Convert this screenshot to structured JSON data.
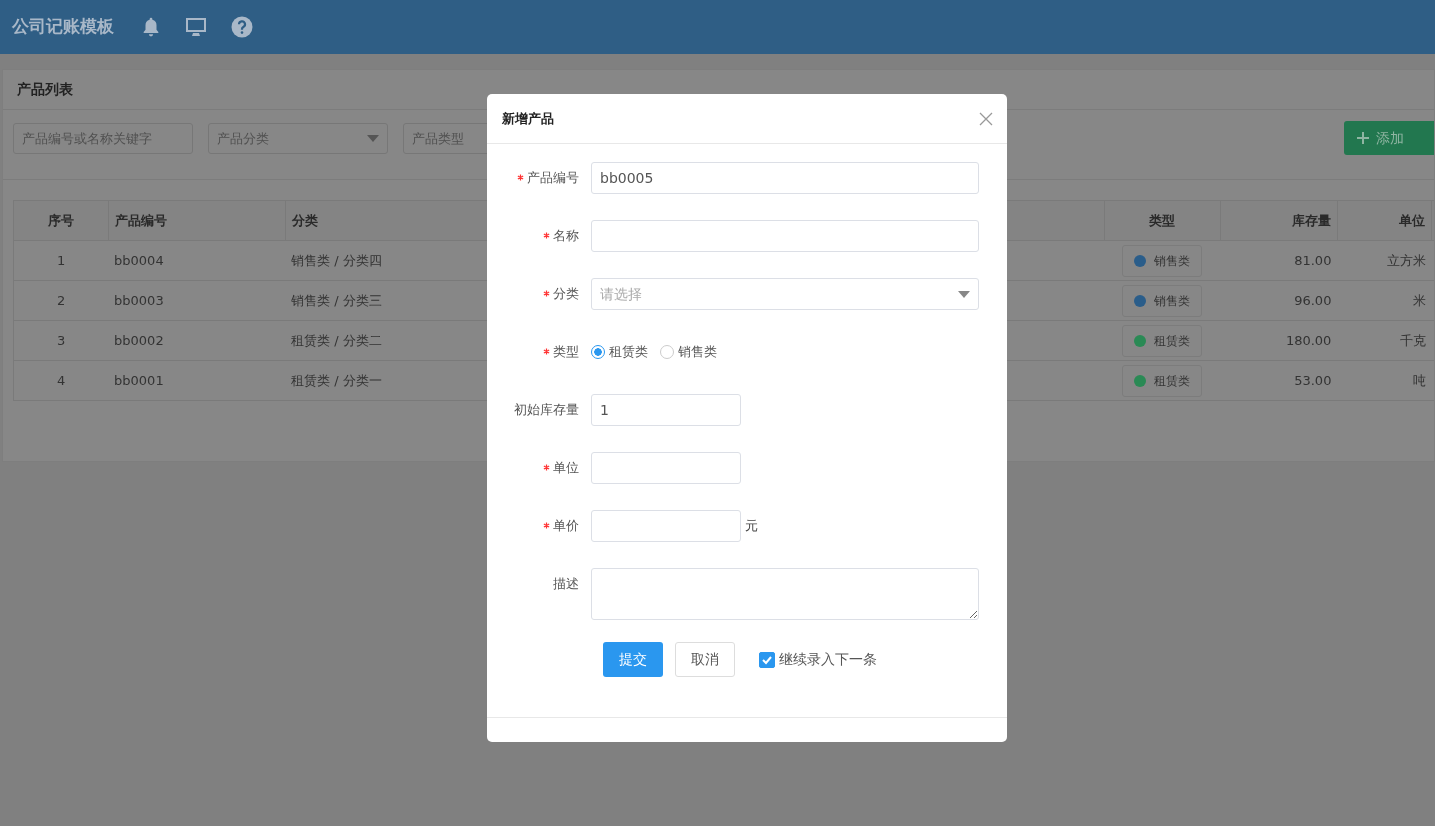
{
  "header": {
    "title": "公司记账模板"
  },
  "panel": {
    "title": "产品列表",
    "filters": [
      {
        "kind": "input",
        "placeholder": "产品编号或名称关键字"
      },
      {
        "kind": "select",
        "placeholder": "产品分类"
      },
      {
        "kind": "input",
        "placeholder": "产品类型"
      }
    ],
    "add_button": "添加"
  },
  "table": {
    "columns": [
      "序号",
      "产品编号",
      "分类",
      "类型",
      "库存量",
      "单位"
    ],
    "rows": [
      {
        "index": "1",
        "code": "bb0004",
        "category": "销售类 / 分类四",
        "type": {
          "label": "销售类",
          "color": "#2a5d8a"
        },
        "stock": "81.00",
        "unit": "立方米"
      },
      {
        "index": "2",
        "code": "bb0003",
        "category": "销售类 / 分类三",
        "type": {
          "label": "销售类",
          "color": "#2a5d8a"
        },
        "stock": "96.00",
        "unit": "米"
      },
      {
        "index": "3",
        "code": "bb0002",
        "category": "租赁类 / 分类二",
        "type": {
          "label": "租赁类",
          "color": "#2a8a55"
        },
        "stock": "180.00",
        "unit": "千克"
      },
      {
        "index": "4",
        "code": "bb0001",
        "category": "租赁类 / 分类一",
        "type": {
          "label": "租赁类",
          "color": "#2a8a55"
        },
        "stock": "53.00",
        "unit": "吨"
      }
    ]
  },
  "dialog": {
    "title": "新增产品",
    "fields": [
      {
        "kind": "text",
        "label": "产品编号",
        "required": true,
        "value": "bb0005"
      },
      {
        "kind": "text",
        "label": "名称",
        "required": true
      },
      {
        "kind": "select",
        "label": "分类",
        "required": true,
        "placeholder": "请选择"
      },
      {
        "kind": "radio",
        "label": "类型",
        "required": true,
        "options": [
          {
            "label": "租赁类",
            "selected": true
          },
          {
            "label": "销售类",
            "selected": false
          }
        ]
      },
      {
        "kind": "short",
        "label": "初始库存量",
        "required": false,
        "value": "1"
      },
      {
        "kind": "short",
        "label": "单位",
        "required": true
      },
      {
        "kind": "short",
        "label": "单价",
        "required": true,
        "suffix": "元"
      },
      {
        "kind": "textarea",
        "label": "描述",
        "required": false
      }
    ],
    "submit": "提交",
    "cancel": "取消",
    "continue": {
      "label": "继续录入下一条",
      "checked": true
    }
  }
}
